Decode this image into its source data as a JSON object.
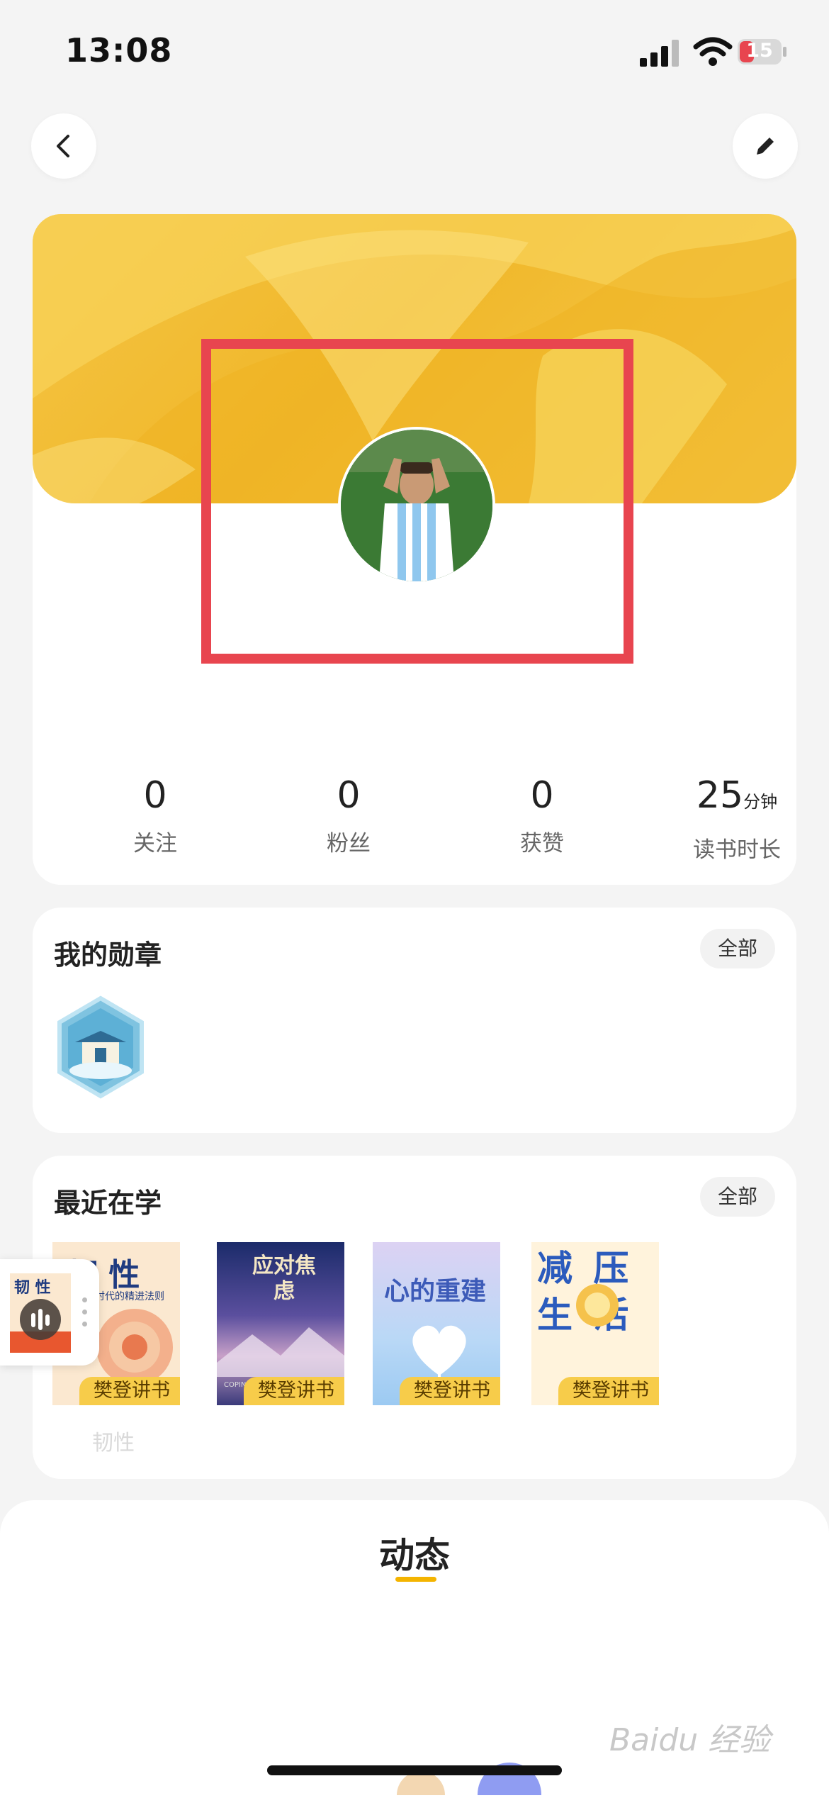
{
  "status_bar": {
    "time": "13:08",
    "battery": "15"
  },
  "header": {
    "back_icon": "chevron-left-icon",
    "edit_icon": "pencil-icon"
  },
  "profile": {
    "stats": [
      {
        "value": "0",
        "unit": "",
        "label": "关注"
      },
      {
        "value": "0",
        "unit": "",
        "label": "粉丝"
      },
      {
        "value": "0",
        "unit": "",
        "label": "获赞"
      },
      {
        "value": "25",
        "unit": "分钟",
        "label": "读书时长"
      }
    ],
    "highlight_color": "#e8454f",
    "banner_color": "#f5c544"
  },
  "badges": {
    "title": "我的勋章",
    "all_label": "全部"
  },
  "recent": {
    "title": "最近在学",
    "all_label": "全部",
    "books": [
      {
        "cover_title": "韧 性",
        "cover_subtitle": "时代的精进法则",
        "tag": "樊登讲书",
        "name": "韧性"
      },
      {
        "cover_title": "应对焦虑",
        "cover_subtitle": "COPING WITH ANXIETY",
        "tag": "樊登讲书"
      },
      {
        "cover_title": "心的重建",
        "tag": "樊登讲书"
      },
      {
        "cover_title": "减 压 生 活",
        "tag": "樊登讲书"
      }
    ]
  },
  "mini_player": {
    "cover_title": "韧 性"
  },
  "feed": {
    "title": "动态"
  },
  "watermark": "Baidu 经验"
}
